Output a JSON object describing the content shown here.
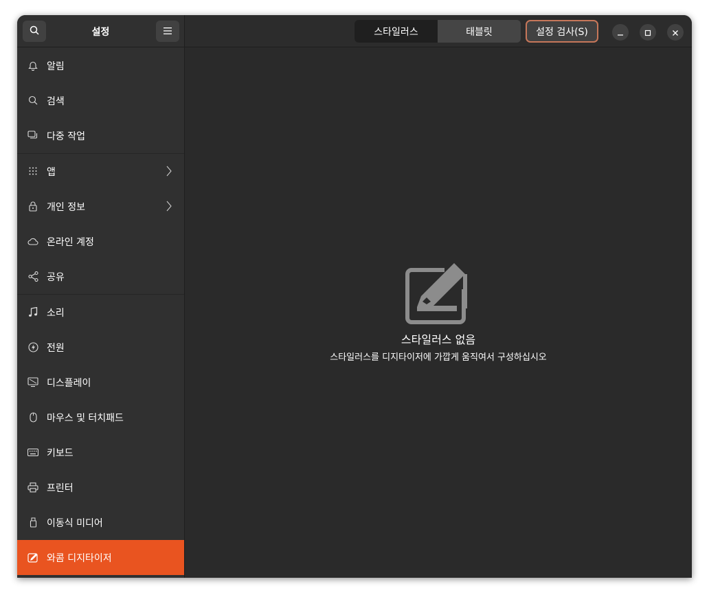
{
  "sidebar": {
    "title": "설정",
    "search_icon": "search-icon",
    "menu_icon": "hamburger-menu-icon",
    "items": [
      {
        "label": "알림",
        "icon": "bell-icon"
      },
      {
        "label": "검색",
        "icon": "search-icon"
      },
      {
        "label": "다중 작업",
        "icon": "multitasking-icon"
      },
      {
        "label": "앱",
        "icon": "apps-grid-icon",
        "has_submenu": true
      },
      {
        "label": "개인 정보",
        "icon": "lock-icon",
        "has_submenu": true
      },
      {
        "label": "온라인 계정",
        "icon": "cloud-icon"
      },
      {
        "label": "공유",
        "icon": "share-icon"
      },
      {
        "label": "소리",
        "icon": "music-note-icon"
      },
      {
        "label": "전원",
        "icon": "power-icon"
      },
      {
        "label": "디스플레이",
        "icon": "display-icon"
      },
      {
        "label": "마우스 및 터치패드",
        "icon": "mouse-icon"
      },
      {
        "label": "키보드",
        "icon": "keyboard-icon"
      },
      {
        "label": "프린터",
        "icon": "printer-icon"
      },
      {
        "label": "이동식 미디어",
        "icon": "usb-drive-icon"
      },
      {
        "label": "와콤 디지타이저",
        "icon": "tablet-pen-icon",
        "active": true
      }
    ]
  },
  "header": {
    "tabs": [
      {
        "label": "스타일러스",
        "selected": true
      },
      {
        "label": "태블릿",
        "selected": false
      }
    ],
    "check_button_label": "설정 검사(S)",
    "window_controls": [
      "minimize-icon",
      "maximize-icon",
      "close-icon"
    ]
  },
  "main": {
    "empty_icon": "tablet-pen-icon",
    "empty_title": "스타일러스 없음",
    "empty_description": "스타일러스를 디지타이저에 가깝게 움직여서 구성하십시오"
  },
  "colors": {
    "accent": "#e95420",
    "sidebar_bg": "#303030",
    "content_bg": "#2a2a2a",
    "focus_border": "#c7775a"
  }
}
